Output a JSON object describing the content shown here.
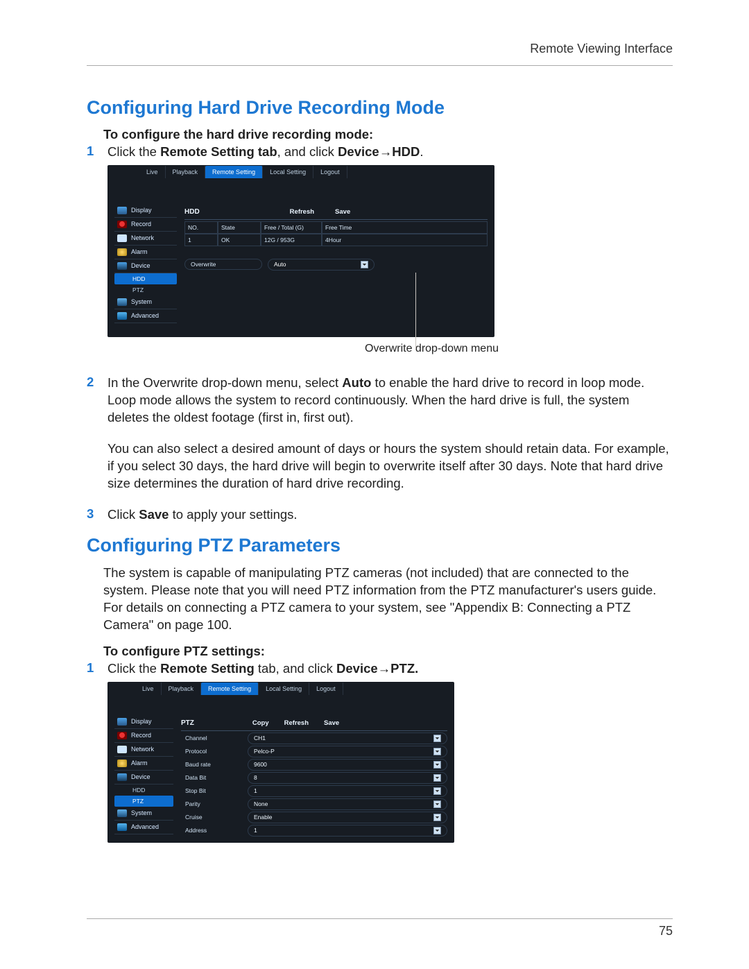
{
  "header": {
    "right": "Remote Viewing Interface"
  },
  "page_number": "75",
  "section1": {
    "title": "Configuring Hard Drive Recording Mode",
    "subhead": "To configure the hard drive recording mode:",
    "steps": {
      "s1_num": "1",
      "s1_a": "Click the ",
      "s1_b": "Remote Setting tab",
      "s1_c": ", and click ",
      "s1_d": "Device→HDD",
      "s1_e": ".",
      "s2_num": "2",
      "s2_a": "In the Overwrite drop-down menu, select ",
      "s2_b": "Auto",
      "s2_c": " to enable the hard drive to record in loop mode. Loop mode allows the system to record continuously. When the hard drive is full, the system deletes the oldest footage (first in, first out).",
      "s2_p2": "You can also select a desired amount of days or hours the system should retain data. For example, if you select 30 days, the hard drive will begin to overwrite itself after 30 days. Note that hard drive size determines the duration of hard drive recording.",
      "s3_num": "3",
      "s3_a": "Click ",
      "s3_b": "Save",
      "s3_c": " to apply your settings."
    },
    "callout": "Overwrite drop-down menu"
  },
  "section2": {
    "title": "Configuring PTZ Parameters",
    "intro": "The system is capable of manipulating PTZ cameras (not included) that are connected to the system. Please note that you will need PTZ information from the PTZ manufacturer's users guide. For details on connecting a PTZ camera to your system, see \"Appendix B: Connecting a PTZ Camera\" on page 100.",
    "subhead": "To configure PTZ settings:",
    "step1": {
      "num": "1",
      "a": "Click the ",
      "b": "Remote Setting",
      "c": " tab, and click ",
      "d": "Device→PTZ."
    }
  },
  "shot_common": {
    "topnav": {
      "live": "Live",
      "playback": "Playback",
      "remote": "Remote Setting",
      "local": "Local Setting",
      "logout": "Logout"
    },
    "sidebar": {
      "display": "Display",
      "record": "Record",
      "network": "Network",
      "alarm": "Alarm",
      "device": "Device",
      "hdd": "HDD",
      "ptz": "PTZ",
      "system": "System",
      "advanced": "Advanced"
    }
  },
  "shot_hdd": {
    "panel_title": "HDD",
    "refresh": "Refresh",
    "save": "Save",
    "headers": {
      "no": "NO.",
      "state": "State",
      "free": "Free / Total (G)",
      "freetime": "Free Time"
    },
    "row": {
      "no": "1",
      "state": "OK",
      "free": "12G / 953G",
      "freetime": "4Hour"
    },
    "overwrite_label": "Overwrite",
    "overwrite_value": "Auto"
  },
  "shot_ptz": {
    "panel_title": "PTZ",
    "copy": "Copy",
    "refresh": "Refresh",
    "save": "Save",
    "rows": {
      "channel_l": "Channel",
      "channel_v": "CH1",
      "protocol_l": "Protocol",
      "protocol_v": "Pelco-P",
      "baud_l": "Baud rate",
      "baud_v": "9600",
      "databit_l": "Data Bit",
      "databit_v": "8",
      "stopbit_l": "Stop Bit",
      "stopbit_v": "1",
      "parity_l": "Parity",
      "parity_v": "None",
      "cruise_l": "Cruise",
      "cruise_v": "Enable",
      "address_l": "Address",
      "address_v": "1"
    }
  }
}
